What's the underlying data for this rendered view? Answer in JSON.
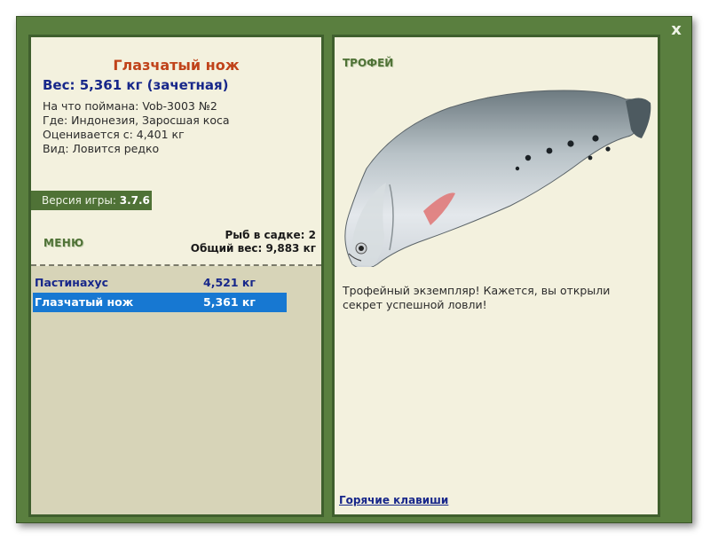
{
  "window": {
    "close_label": "x"
  },
  "fish_info": {
    "title": "Глазчатый нож",
    "weight_line": "Вес: 5,361 кг (зачетная)",
    "caught_on": "На что поймана: Vob-3003 №2",
    "location": "Где: Индонезия, Заросшая коса",
    "valued_from": "Оценивается с: 4,401 кг",
    "type": "Вид: Ловится редко"
  },
  "version": {
    "label": "Версия игры:",
    "value": "3.7.6"
  },
  "menu": {
    "label": "МЕНЮ"
  },
  "keepnet": {
    "count_label": "Рыб в садке: 2",
    "total_label": "Общий вес: 9,883 кг"
  },
  "catch_list": [
    {
      "name": "Пастинахус",
      "weight": "4,521 кг",
      "selected": false
    },
    {
      "name": "Глазчатый нож",
      "weight": "5,361 кг",
      "selected": true
    }
  ],
  "trophy": {
    "label": "ТРОФЕЙ",
    "image_icon": "clown-knifefish-image",
    "text": "Трофейный экземпляр! Кажется, вы открыли секрет успешной ловли!"
  },
  "hotkeys": {
    "label": "Горячие клавиши"
  },
  "colors": {
    "frame_green": "#5a7f3f",
    "panel_bg": "#f3f1de",
    "list_bg": "#d7d4b8",
    "title_orange": "#c0431a",
    "navy": "#17278a",
    "selection_blue": "#1778d2"
  }
}
